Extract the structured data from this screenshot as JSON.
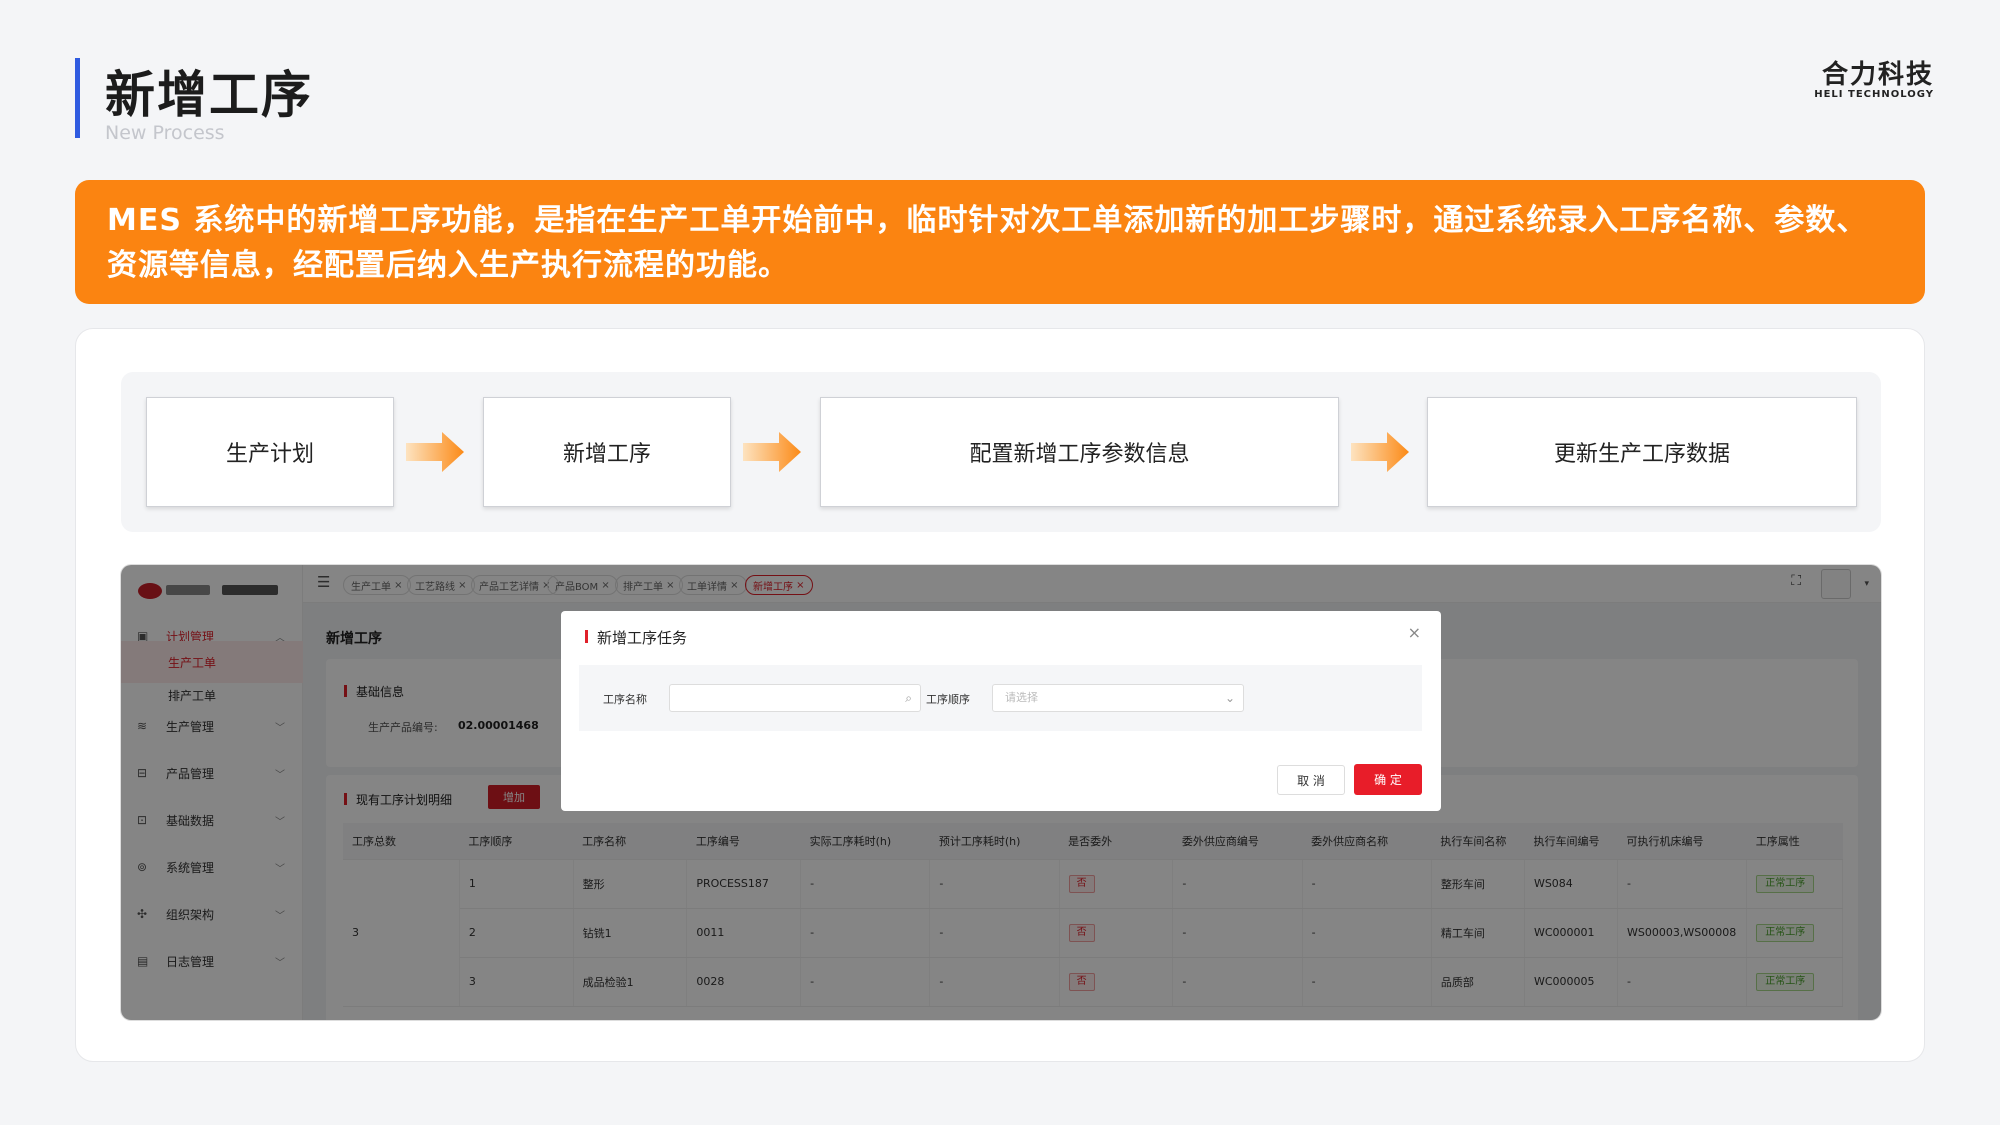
{
  "header": {
    "title": "新增工序",
    "subtitle": "New Process",
    "logo_cn": "合力科技",
    "logo_en": "HELI TECHNOLOGY"
  },
  "banner": {
    "text": "MES 系统中的新增工序功能，是指在生产工单开始前中，临时针对次工单添加新的加工步骤时，通过系统录入工序名称、参数、资源等信息，经配置后纳入生产执行流程的功能。"
  },
  "flow": {
    "steps": [
      "生产计划",
      "新增工序",
      "配置新增工序参数信息",
      "更新生产工序数据"
    ]
  },
  "app": {
    "sidebar": {
      "menus": [
        {
          "label": "计划管理",
          "icon": "calendar-icon"
        },
        {
          "label": "生产管理",
          "icon": "layers-icon"
        },
        {
          "label": "产品管理",
          "icon": "box-icon"
        },
        {
          "label": "基础数据",
          "icon": "database-icon"
        },
        {
          "label": "系统管理",
          "icon": "settings-icon"
        },
        {
          "label": "组织架构",
          "icon": "org-icon"
        },
        {
          "label": "日志管理",
          "icon": "log-icon"
        }
      ],
      "subitems": [
        "生产工单",
        "排产工单"
      ]
    },
    "tabs": [
      "生产工单",
      "工艺路线",
      "产品工艺详情",
      "产品BOM",
      "排产工单",
      "工单详情",
      "新增工序"
    ],
    "page_title": "新增工序",
    "basic_info": {
      "heading": "基础信息",
      "product_code_label": "生产产品编号:",
      "product_code_value": "02.00001468"
    },
    "plan_section": {
      "heading": "现有工序计划明细",
      "add_label": "增加"
    },
    "table": {
      "headers": [
        "工序总数",
        "工序顺序",
        "工序名称",
        "工序编号",
        "实际工序耗时(h)",
        "预计工序耗时(h)",
        "是否委外",
        "委外供应商编号",
        "委外供应商名称",
        "执行车间名称",
        "执行车间编号",
        "可执行机床编号",
        "工序属性"
      ],
      "total": "3",
      "rows": [
        {
          "order": "1",
          "name": "整形",
          "code": "PROCESS187",
          "actual": "-",
          "expected": "-",
          "outsourced": "否",
          "supplier_code": "-",
          "supplier_name": "-",
          "workshop": "整形车间",
          "workshop_code": "WS084",
          "machines": "-",
          "attr": "正常工序"
        },
        {
          "order": "2",
          "name": "钻铣1",
          "code": "0011",
          "actual": "-",
          "expected": "-",
          "outsourced": "否",
          "supplier_code": "-",
          "supplier_name": "-",
          "workshop": "精工车间",
          "workshop_code": "WC000001",
          "machines": "WS00003,WS00008",
          "attr": "正常工序"
        },
        {
          "order": "3",
          "name": "成品检验1",
          "code": "0028",
          "actual": "-",
          "expected": "-",
          "outsourced": "否",
          "supplier_code": "-",
          "supplier_name": "-",
          "workshop": "品质部",
          "workshop_code": "WC000005",
          "machines": "-",
          "attr": "正常工序"
        }
      ]
    },
    "dialog": {
      "title": "新增工序任务",
      "name_label": "工序名称",
      "order_label": "工序顺序",
      "order_placeholder": "请选择",
      "cancel_label": "取 消",
      "confirm_label": "确 定"
    }
  },
  "colors": {
    "accent": "#2f5be0",
    "banner": "#fb8411",
    "brand_red": "#e0202a"
  }
}
